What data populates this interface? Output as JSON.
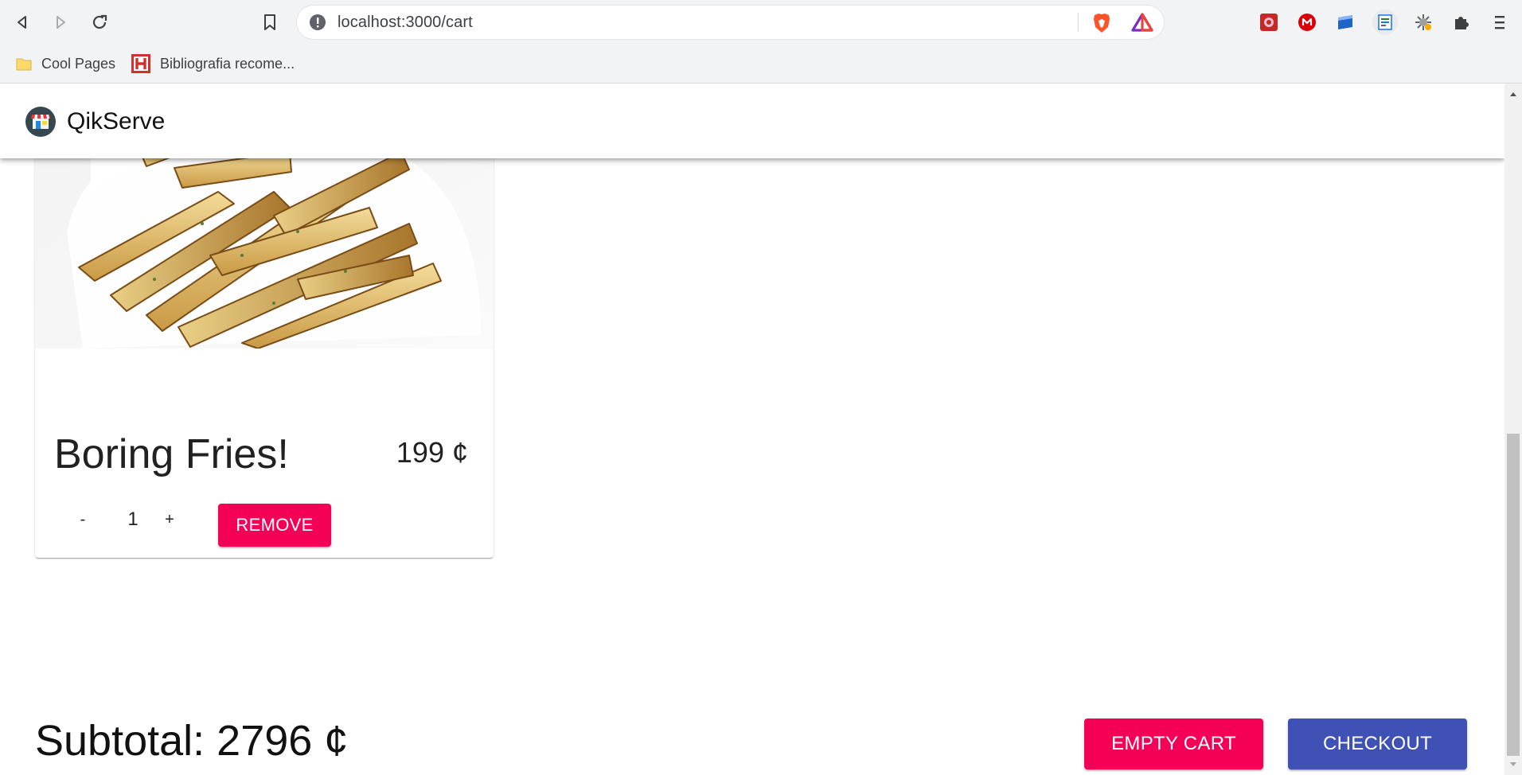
{
  "browser": {
    "url": "localhost:3000/cart",
    "bookmarks": [
      {
        "label": "Cool Pages",
        "icon": "folder-icon"
      },
      {
        "label": "Bibliografia recome...",
        "icon": "h-logo-icon"
      }
    ]
  },
  "app": {
    "brand": "QikServe",
    "logo_icon": "store-icon"
  },
  "cart": {
    "items": [
      {
        "name": "Boring Fries!",
        "price": "199 ¢",
        "quantity": "1",
        "decrement_label": "-",
        "increment_label": "+",
        "remove_label": "REMOVE"
      }
    ],
    "subtotal": "Subtotal: 2796 ¢",
    "empty_label": "EMPTY CART",
    "checkout_label": "CHECKOUT"
  },
  "colors": {
    "pink": "#f50057",
    "indigo": "#3f51b5"
  }
}
